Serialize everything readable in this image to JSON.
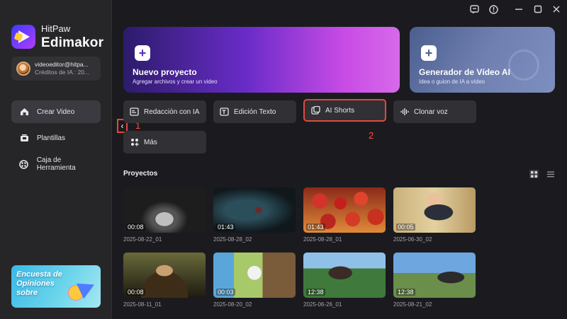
{
  "app": {
    "brand_line1": "HitPaw",
    "brand_line2": "Edimakor",
    "account_email": "videoeditor@hitpa...",
    "account_credits": "Créditos de IA : 20..."
  },
  "sidebar": {
    "items": [
      {
        "label": "Crear Video",
        "icon": "home-icon",
        "active": true
      },
      {
        "label": "Plantillas",
        "icon": "template-icon",
        "active": false
      },
      {
        "label": "Caja de Herramienta",
        "icon": "toolbox-icon",
        "active": false
      }
    ],
    "promo_text": "Encuesta de Opiniones sobre"
  },
  "titlebar": {
    "icons": [
      "feedback-icon",
      "info-icon",
      "minimize-icon",
      "maximize-icon",
      "close-icon"
    ]
  },
  "hero": {
    "new_project": {
      "title": "Nuevo proyecto",
      "subtitle": "Agregar archivos y crear un video"
    },
    "ai_generator": {
      "title": "Generador de Vídeo AI",
      "subtitle": "Idea o guion de IA a vídeo"
    }
  },
  "tools": [
    {
      "label": "Redacción con IA",
      "icon": "ai-write-icon"
    },
    {
      "label": "Edición Texto",
      "icon": "text-edit-icon"
    },
    {
      "label": "AI Shorts",
      "icon": "ai-shorts-icon",
      "highlighted": true
    },
    {
      "label": "Clonar voz",
      "icon": "voice-clone-icon"
    },
    {
      "label": "Más",
      "icon": "more-icon"
    }
  ],
  "annotations": {
    "marker1": "1",
    "marker2": "2",
    "collapse_glyph": "‹"
  },
  "projects": {
    "title": "Proyectos",
    "items": [
      {
        "duration": "00:08",
        "name": "2025-08-22_01"
      },
      {
        "duration": "01:43",
        "name": "2025-08-28_02"
      },
      {
        "duration": "01:43",
        "name": "2025-08-28_01"
      },
      {
        "duration": "00:05",
        "name": "2025-06-30_02"
      },
      {
        "duration": "00:08",
        "name": "2025-08-11_01"
      },
      {
        "duration": "00:03",
        "name": "2025-08-20_02"
      },
      {
        "duration": "12:38",
        "name": "2025-06-26_01"
      },
      {
        "duration": "12:38",
        "name": "2025-08-21_02"
      }
    ]
  },
  "colors": {
    "accent_red": "#e24a3b",
    "hero_purple": "#6a2cc9",
    "sidebar_bg": "#262629"
  }
}
